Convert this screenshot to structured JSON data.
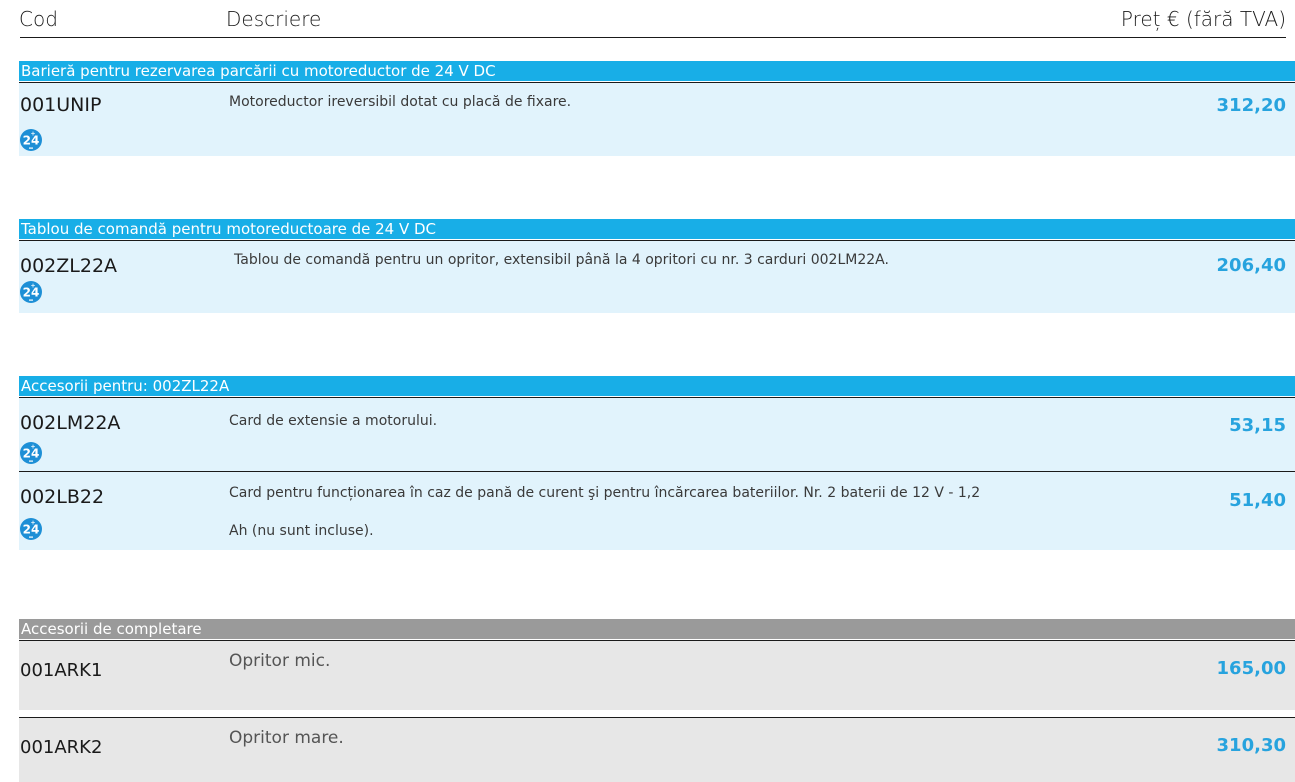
{
  "headers": {
    "code": "Cod",
    "description": "Descriere",
    "price": "Preț € (fără TVA)"
  },
  "sections": [
    {
      "title": "Barieră pentru rezervarea parcării cu motoreductor de 24 V DC",
      "items": [
        {
          "code": "001UNIP",
          "description": "Motoreductor ireversibil dotat cu placă de fixare.",
          "price": "312,20",
          "badge": "24"
        }
      ]
    },
    {
      "title": "Tablou de comandă pentru motoreductoare de 24 V DC",
      "items": [
        {
          "code": "002ZL22A",
          "description": "Tablou de comandă pentru un opritor, extensibil până la 4 opritori cu nr. 3 carduri 002LM22A.",
          "price": "206,40",
          "badge": "24"
        }
      ]
    },
    {
      "title": "Accesorii pentru: 002ZL22A",
      "items": [
        {
          "code": "002LM22A",
          "description": "Card de extensie a motorului.",
          "price": "53,15",
          "badge": "24"
        },
        {
          "code": "002LB22",
          "description_line1": "Card pentru funcționarea în caz de pană de curent şi pentru încărcarea bateriilor. Nr. 2 baterii de 12 V - 1,2",
          "description_line2": "Ah (nu sunt incluse).",
          "price": "51,40",
          "badge": "24"
        }
      ]
    },
    {
      "title": "Accesorii de completare",
      "items": [
        {
          "code": "001ARK1",
          "description": "Opritor mic.",
          "price": "165,00"
        },
        {
          "code": "001ARK2",
          "description": "Opritor mare.",
          "price": "310,30"
        }
      ]
    }
  ],
  "colors": {
    "section_blue": "#18aee7",
    "section_grey": "#9a9a9a",
    "row_blue": "#e1f3fc",
    "row_grey": "#e7e7e7",
    "price_blue": "#27a3de",
    "badge_blue": "#1d8fd6"
  },
  "icons": {
    "badge": "24v-dc-badge-icon"
  }
}
